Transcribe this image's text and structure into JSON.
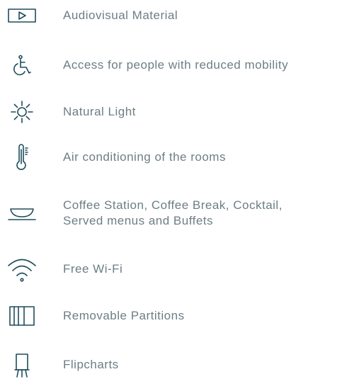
{
  "amenities": [
    {
      "icon": "play-screen-icon",
      "label": "Audiovisual Material"
    },
    {
      "icon": "wheelchair-icon",
      "label": "Access for people with reduced mobility"
    },
    {
      "icon": "sun-icon",
      "label": "Natural Light"
    },
    {
      "icon": "thermometer-icon",
      "label": "Air conditioning of the rooms"
    },
    {
      "icon": "coffee-cup-icon",
      "label": "Coffee Station, Coffee Break, Cocktail,\nServed menus and Buffets"
    },
    {
      "icon": "wifi-icon",
      "label": "Free Wi-Fi"
    },
    {
      "icon": "partitions-icon",
      "label": "Removable Partitions"
    },
    {
      "icon": "flipchart-icon",
      "label": "Flipcharts"
    }
  ],
  "colors": {
    "icon": "#1e4d5c",
    "text": "#6d7e85",
    "background": "#ffffff"
  }
}
